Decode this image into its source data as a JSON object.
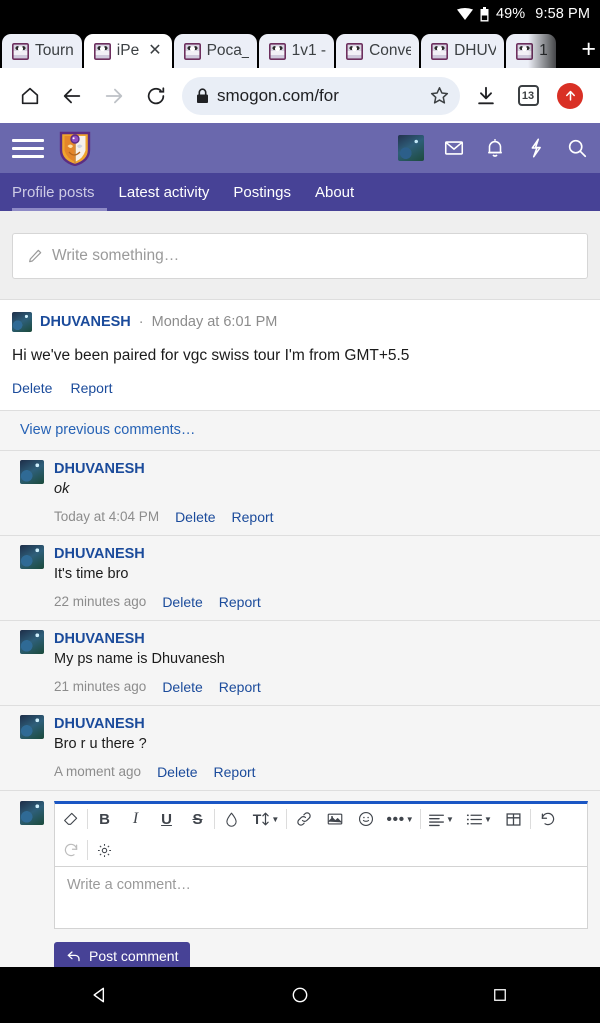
{
  "status_bar": {
    "wifi_icon": "wifi-icon",
    "battery_icon": "battery-icon",
    "battery_percent": "49%",
    "time": "9:58 PM"
  },
  "browser": {
    "tabs": [
      {
        "title": "Tourn",
        "active": false,
        "closable": false
      },
      {
        "title": "iPe",
        "active": true,
        "closable": true
      },
      {
        "title": "Poca_",
        "active": false,
        "closable": false
      },
      {
        "title": "1v1 -",
        "active": false,
        "closable": false
      },
      {
        "title": "Conve",
        "active": false,
        "closable": false
      },
      {
        "title": "DHUV",
        "active": false,
        "closable": false
      },
      {
        "title": "1",
        "active": false,
        "closable": false
      }
    ],
    "new_tab_label": "+",
    "toolbar": {
      "home_icon": "home-icon",
      "back_icon": "back-arrow-icon",
      "forward_icon": "forward-arrow-icon",
      "reload_icon": "reload-icon",
      "lock_icon": "lock-icon",
      "url": "smogon.com/for",
      "bookmark_icon": "star-icon",
      "download_icon": "download-icon",
      "tab_count": "13",
      "profile_icon": "profile-update-icon"
    }
  },
  "site_header": {
    "menu_icon": "hamburger-menu-icon",
    "logo_icon": "smogon-crest-logo",
    "avatar_icon": "user-avatar",
    "inbox_icon": "envelope-icon",
    "alerts_icon": "bell-icon",
    "bolt_icon": "lightning-bolt-icon",
    "search_icon": "search-icon",
    "brand_color": "#6a68ad",
    "subnav_color": "#474296"
  },
  "subnav": {
    "items": [
      {
        "label": "Profile posts",
        "active": true
      },
      {
        "label": "Latest activity",
        "active": false
      },
      {
        "label": "Postings",
        "active": false
      },
      {
        "label": "About",
        "active": false
      }
    ]
  },
  "write_something": {
    "pencil_icon": "pencil-icon",
    "placeholder": "Write something…"
  },
  "post": {
    "author": "DHUVANESH",
    "separator": "·",
    "timestamp": "Monday at 6:01 PM",
    "body": "Hi we've been paired for vgc swiss tour I'm from GMT+5.5",
    "delete_label": "Delete",
    "report_label": "Report"
  },
  "comments_section": {
    "view_previous_label": "View previous comments…",
    "comments": [
      {
        "author": "DHUVANESH",
        "text": "ok",
        "italic": true,
        "time": "Today at 4:04 PM",
        "delete_label": "Delete",
        "report_label": "Report"
      },
      {
        "author": "DHUVANESH",
        "text": "It's time bro",
        "italic": false,
        "time": "22 minutes ago",
        "delete_label": "Delete",
        "report_label": "Report"
      },
      {
        "author": "DHUVANESH",
        "text": "My ps name is Dhuvanesh",
        "italic": false,
        "time": "21 minutes ago",
        "delete_label": "Delete",
        "report_label": "Report"
      },
      {
        "author": "DHUVANESH",
        "text": "Bro r u there ?",
        "italic": false,
        "time": "A moment ago",
        "delete_label": "Delete",
        "report_label": "Report"
      }
    ]
  },
  "editor": {
    "accent_color": "#1a56c4",
    "toolbar_row1": [
      {
        "name": "remove-formatting-icon",
        "glyph": "eraser",
        "label": ""
      },
      {
        "name": "bold-icon",
        "glyph": "text",
        "label": "B"
      },
      {
        "name": "italic-icon",
        "glyph": "text-italic",
        "label": "I"
      },
      {
        "name": "underline-icon",
        "glyph": "text-underline",
        "label": "U"
      },
      {
        "name": "strikethrough-icon",
        "glyph": "text-strike",
        "label": "S"
      },
      {
        "name": "text-color-icon",
        "glyph": "droplet",
        "label": ""
      },
      {
        "name": "font-size-icon",
        "glyph": "font-size",
        "label": "T"
      },
      {
        "name": "insert-link-icon",
        "glyph": "link",
        "label": ""
      },
      {
        "name": "insert-image-icon",
        "glyph": "image",
        "label": ""
      },
      {
        "name": "insert-emoji-icon",
        "glyph": "smiley",
        "label": ""
      },
      {
        "name": "more-options-icon",
        "glyph": "ellipsis",
        "label": ""
      },
      {
        "name": "text-align-icon",
        "glyph": "align",
        "label": ""
      },
      {
        "name": "list-icon",
        "glyph": "list",
        "label": ""
      },
      {
        "name": "insert-table-icon",
        "glyph": "table",
        "label": ""
      },
      {
        "name": "undo-icon",
        "glyph": "undo",
        "label": ""
      }
    ],
    "toolbar_row2": [
      {
        "name": "redo-icon",
        "glyph": "redo",
        "label": "",
        "disabled": true
      },
      {
        "name": "editor-settings-icon",
        "glyph": "gear",
        "label": "",
        "disabled": false
      }
    ],
    "comment_placeholder": "Write a comment…",
    "post_button_label": "Post comment",
    "post_button_icon": "reply-arrow-icon",
    "post_button_color": "#474296"
  },
  "android_nav": {
    "back_icon": "nav-back-triangle-icon",
    "home_icon": "nav-home-circle-icon",
    "recents_icon": "nav-recents-square-icon"
  }
}
